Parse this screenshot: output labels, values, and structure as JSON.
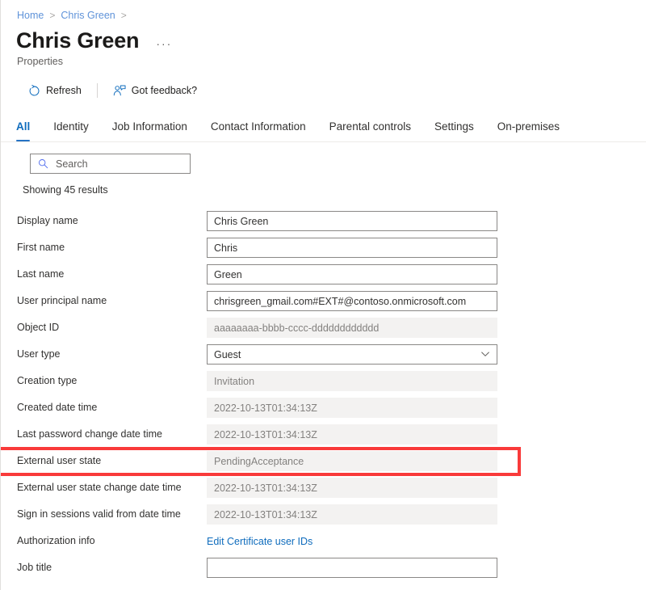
{
  "breadcrumb": {
    "items": [
      {
        "label": "Home",
        "link": true
      },
      {
        "label": "Chris Green",
        "link": true
      }
    ],
    "separator": ">"
  },
  "header": {
    "title": "Chris Green",
    "subtitle": "Properties",
    "more_menu": "···"
  },
  "command_bar": {
    "buttons": [
      {
        "label": "Refresh",
        "icon": "refresh-icon"
      },
      {
        "label": "Got feedback?",
        "icon": "feedback-person-icon"
      }
    ]
  },
  "tabs": [
    {
      "label": "All",
      "active": true
    },
    {
      "label": "Identity",
      "active": false
    },
    {
      "label": "Job Information",
      "active": false
    },
    {
      "label": "Contact Information",
      "active": false
    },
    {
      "label": "Parental controls",
      "active": false
    },
    {
      "label": "Settings",
      "active": false
    },
    {
      "label": "On-premises",
      "active": false
    }
  ],
  "search": {
    "placeholder": "Search",
    "value": "",
    "icon": "search-icon"
  },
  "results_text": "Showing 45 results",
  "properties": [
    {
      "label": "Display name",
      "value": "Chris Green",
      "type": "input"
    },
    {
      "label": "First name",
      "value": "Chris",
      "type": "input"
    },
    {
      "label": "Last name",
      "value": "Green",
      "type": "input"
    },
    {
      "label": "User principal name",
      "value": "chrisgreen_gmail.com#EXT#@contoso.onmicrosoft.com",
      "type": "input"
    },
    {
      "label": "Object ID",
      "value": "aaaaaaaa-bbbb-cccc-dddddddddddd",
      "type": "readonly"
    },
    {
      "label": "User type",
      "value": "Guest",
      "type": "select"
    },
    {
      "label": "Creation type",
      "value": "Invitation",
      "type": "readonly"
    },
    {
      "label": "Created date time",
      "value": "2022-10-13T01:34:13Z",
      "type": "readonly"
    },
    {
      "label": "Last password change date time",
      "value": "2022-10-13T01:34:13Z",
      "type": "readonly"
    },
    {
      "label": "External user state",
      "value": "PendingAcceptance",
      "type": "readonly",
      "highlighted": true
    },
    {
      "label": "External user state change date time",
      "value": "2022-10-13T01:34:13Z",
      "type": "readonly"
    },
    {
      "label": "Sign in sessions valid from date time",
      "value": "2022-10-13T01:34:13Z",
      "type": "readonly"
    },
    {
      "label": "Authorization info",
      "value": "Edit Certificate user IDs",
      "type": "link"
    },
    {
      "label": "Job title",
      "value": "",
      "type": "input"
    }
  ],
  "colors": {
    "accent": "#0f6cbd",
    "tab_underline": "#2673c4",
    "breadcrumb_link": "#5f93d9",
    "highlight": "#f93a3a",
    "readonly_bg": "#f3f2f1",
    "field_border": "#8a8886"
  }
}
